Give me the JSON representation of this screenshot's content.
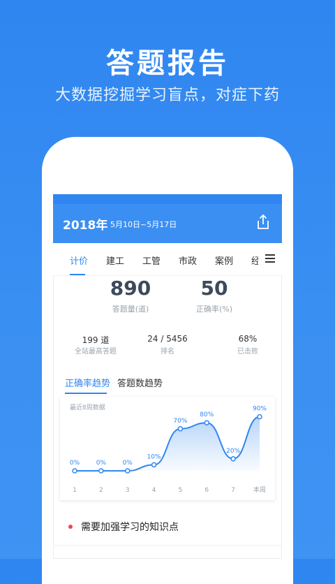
{
  "promo": {
    "title": "答题报告",
    "subtitle": "大数据挖掘学习盲点，对症下药"
  },
  "appbar": {
    "year": "2018年",
    "range": "5月10日~5月17日",
    "share_icon": "share-icon"
  },
  "tabs": [
    {
      "label": "计价",
      "active": true
    },
    {
      "label": "建工",
      "active": false
    },
    {
      "label": "工管",
      "active": false
    },
    {
      "label": "市政",
      "active": false
    },
    {
      "label": "案例",
      "active": false
    },
    {
      "label": "经",
      "active": false
    }
  ],
  "summary": {
    "questions_count": "890",
    "questions_label": "答题量(道)",
    "accuracy": "50",
    "accuracy_label": "正确率(%)"
  },
  "stats": [
    {
      "value": "199 道",
      "label": "全站最高答题"
    },
    {
      "value": "24 / 5456",
      "label": "排名"
    },
    {
      "value": "68%",
      "label": "已击败"
    }
  ],
  "trend_tabs": [
    {
      "label": "正确率趋势",
      "active": true
    },
    {
      "label": "答题数趋势",
      "active": false
    }
  ],
  "chart_data": {
    "type": "area",
    "caption": "最近8周数据",
    "categories": [
      "1",
      "2",
      "3",
      "4",
      "5",
      "6",
      "7",
      "本周"
    ],
    "values": [
      0,
      0,
      0,
      10,
      70,
      80,
      20,
      90
    ],
    "value_labels": [
      "0%",
      "0%",
      "0%",
      "10%",
      "70%",
      "80%",
      "20%",
      "90%"
    ],
    "ylim": [
      0,
      100
    ],
    "grid": false,
    "color": "#2f86f0"
  },
  "weak_section": {
    "title": "需要加强学习的知识点"
  },
  "colors": {
    "brand": "#2f86f0",
    "alert_dot": "#f0474a"
  }
}
